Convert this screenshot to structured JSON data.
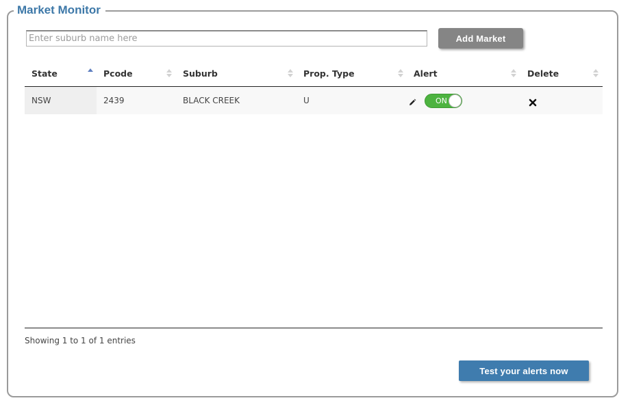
{
  "panel": {
    "title": "Market Monitor"
  },
  "search": {
    "placeholder": "Enter suburb name here",
    "value": ""
  },
  "buttons": {
    "add_market": "Add Market",
    "test_alerts": "Test your alerts now"
  },
  "table": {
    "columns": [
      "State",
      "Pcode",
      "Suburb",
      "Prop. Type",
      "Alert",
      "Delete"
    ],
    "sorted_column": "State",
    "sort_direction": "ascending",
    "rows": [
      {
        "state": "NSW",
        "pcode": "2439",
        "suburb": "BLACK CREEK",
        "prop_type": "U",
        "alert": "ON"
      }
    ],
    "info": "Showing 1 to 1 of 1 entries"
  },
  "icons": {
    "edit": "pencil-icon",
    "delete": "close-icon"
  },
  "colors": {
    "title": "#3d78a8",
    "toggle_on": "#4db340",
    "add_button": "#858585",
    "test_button": "#3f7cae",
    "sort_active": "#5f7fc0"
  }
}
